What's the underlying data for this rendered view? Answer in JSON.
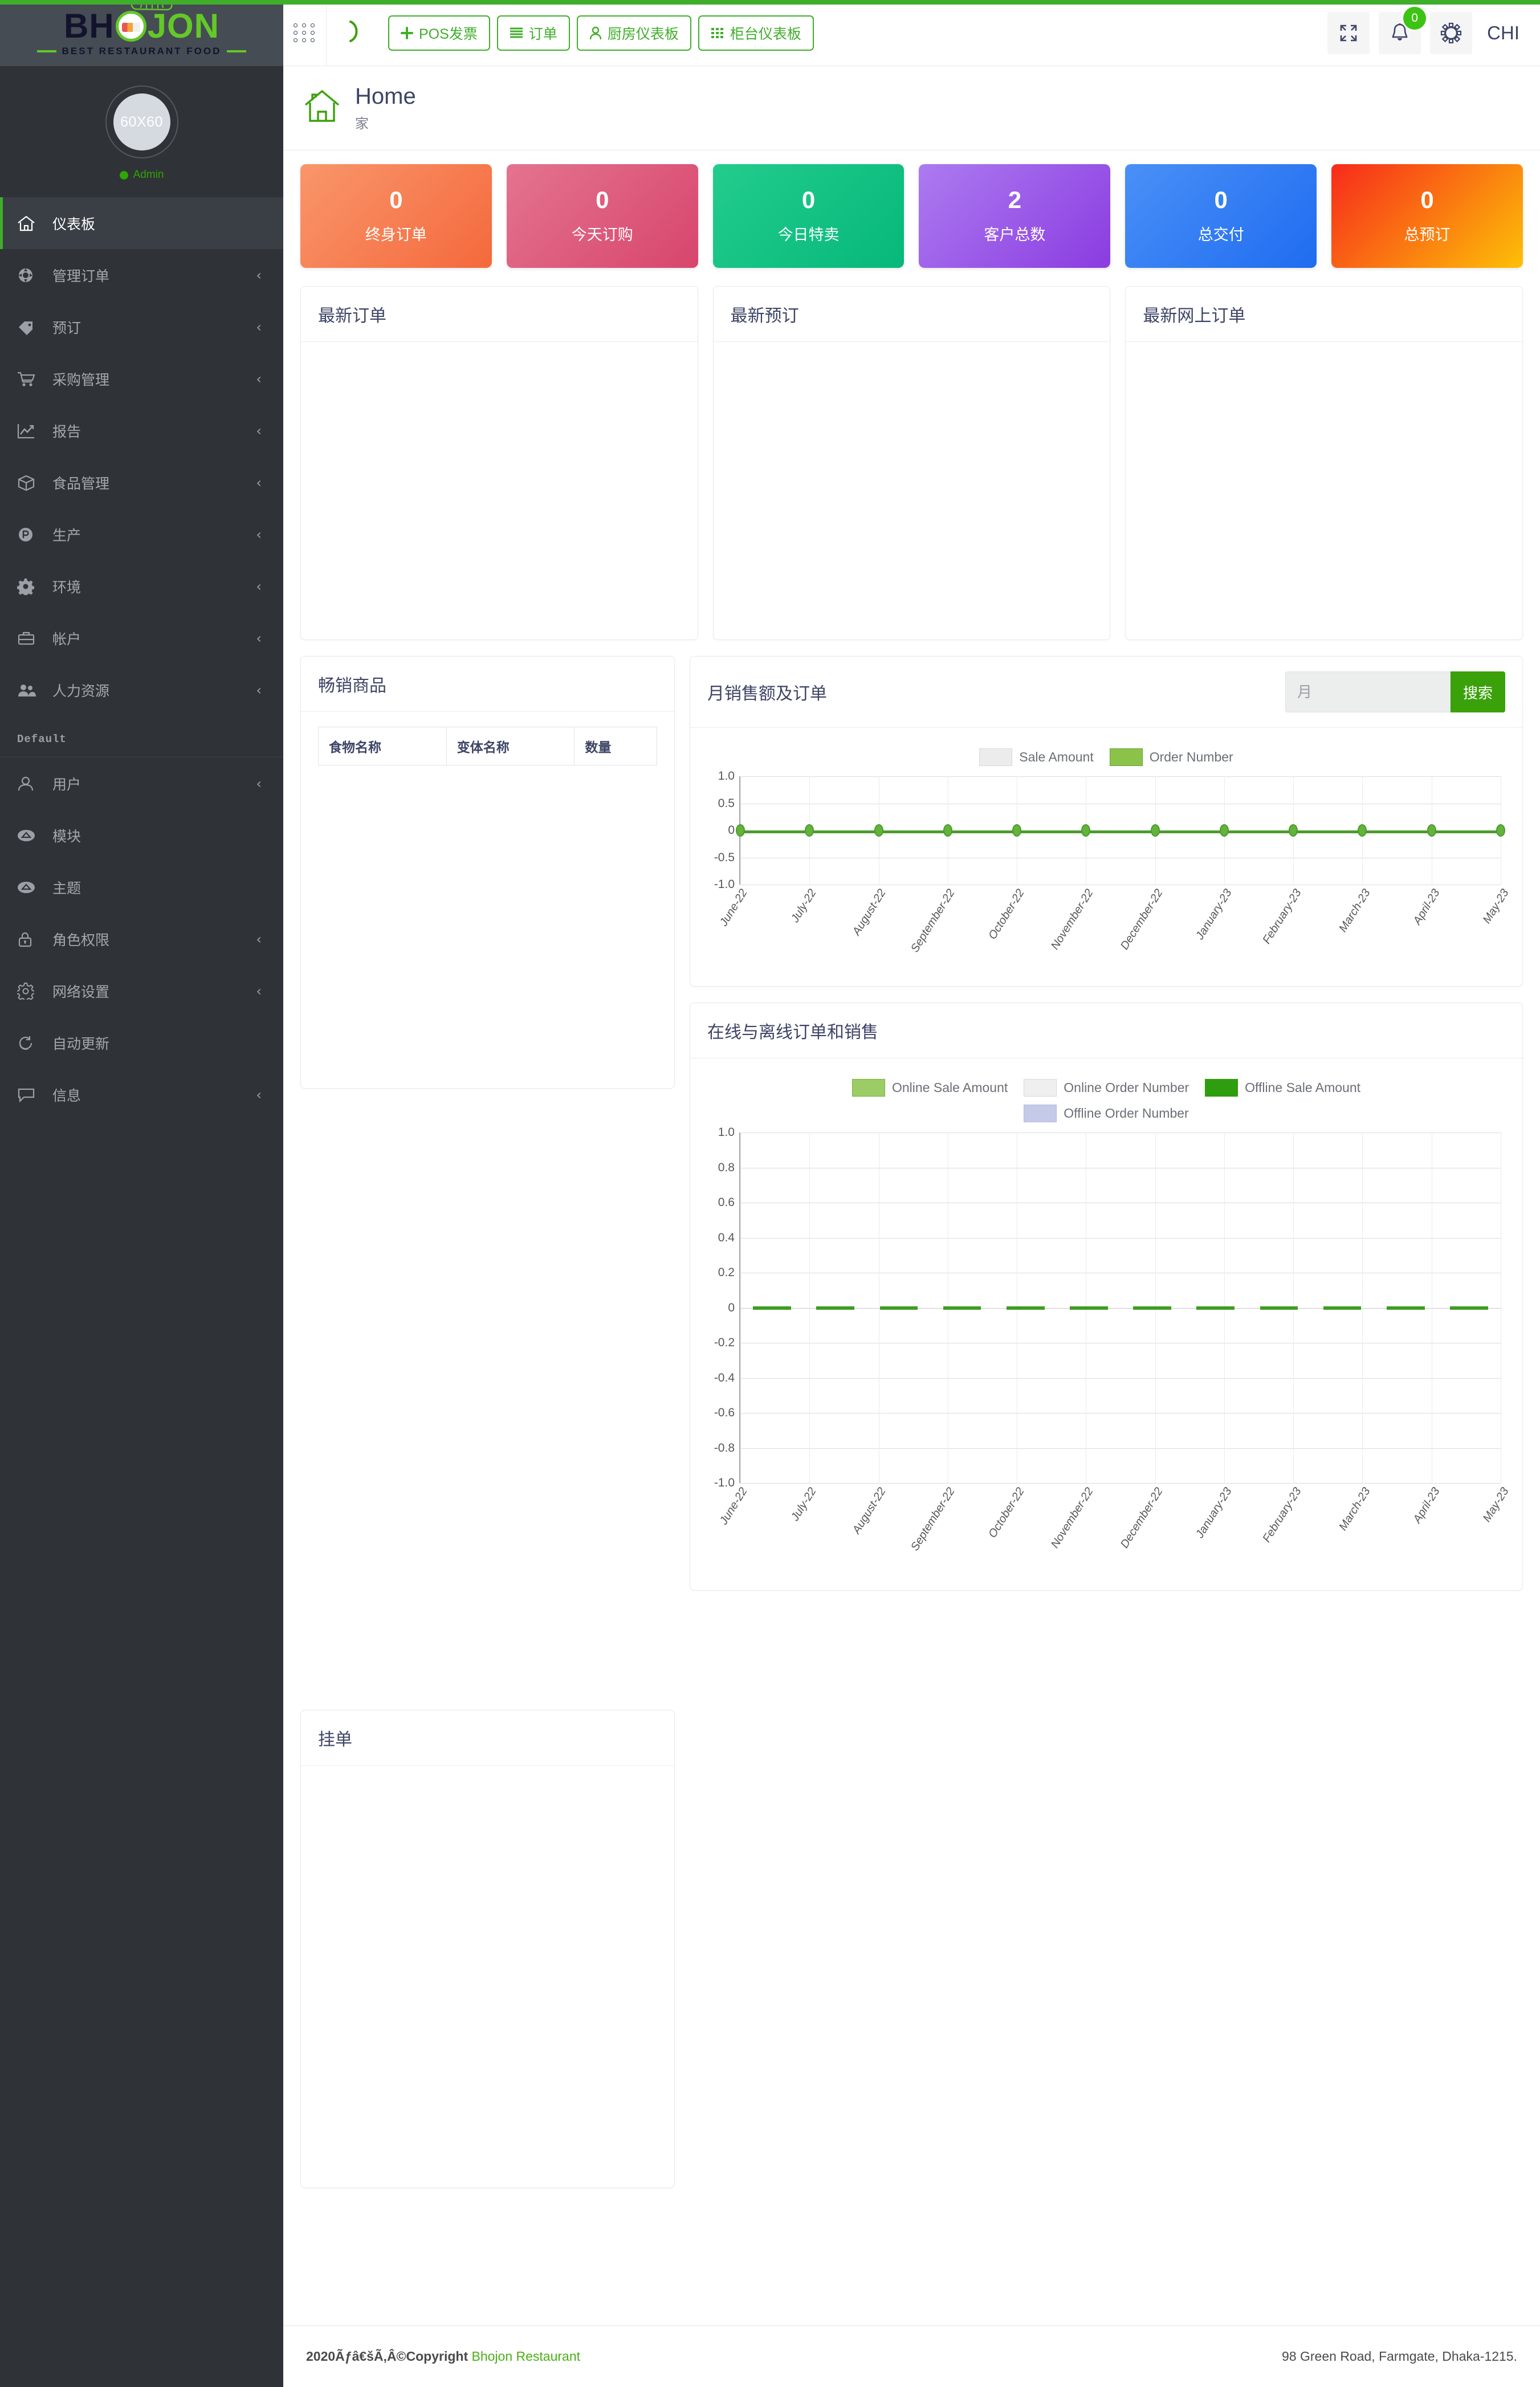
{
  "brand": {
    "logo_bh": "BH",
    "logo_jon": "JON",
    "tagline": "BEST RESTAURANT FOOD"
  },
  "sidebar": {
    "avatar_text": "60X60",
    "role": "Admin",
    "section_label": "Default",
    "items": [
      {
        "label": "仪表板",
        "icon": "home-icon",
        "caret": "",
        "active": true
      },
      {
        "label": "管理订单",
        "icon": "gear-order-icon",
        "caret": "‹",
        "active": false
      },
      {
        "label": "预订",
        "icon": "tag-icon",
        "caret": "‹",
        "active": false
      },
      {
        "label": "采购管理",
        "icon": "cart-icon",
        "caret": "‹",
        "active": false
      },
      {
        "label": "报告",
        "icon": "chart-line-icon",
        "caret": "‹",
        "active": false
      },
      {
        "label": "食品管理",
        "icon": "box-icon",
        "caret": "‹",
        "active": false
      },
      {
        "label": "生产",
        "icon": "p-circle-icon",
        "caret": "‹",
        "active": false
      },
      {
        "label": "环境",
        "icon": "cog-icon",
        "caret": "‹",
        "active": false
      },
      {
        "label": "帐户",
        "icon": "briefcase-icon",
        "caret": "‹",
        "active": false
      },
      {
        "label": "人力资源",
        "icon": "users-icon",
        "caret": "‹",
        "active": false
      }
    ],
    "items2": [
      {
        "label": "用户",
        "icon": "user-icon",
        "caret": "‹"
      },
      {
        "label": "模块",
        "icon": "module-icon",
        "caret": ""
      },
      {
        "label": "主题",
        "icon": "theme-icon",
        "caret": ""
      },
      {
        "label": "角色权限",
        "icon": "lock-icon",
        "caret": "‹"
      },
      {
        "label": "网络设置",
        "icon": "settings-gear-icon",
        "caret": "‹"
      },
      {
        "label": "自动更新",
        "icon": "refresh-icon",
        "caret": ""
      },
      {
        "label": "信息",
        "icon": "message-icon",
        "caret": "‹"
      }
    ]
  },
  "topbar": {
    "buttons": [
      {
        "label": "POS发票",
        "icon": "plus-icon"
      },
      {
        "label": "订单",
        "icon": "list-icon"
      },
      {
        "label": "厨房仪表板",
        "icon": "user-chef-icon"
      },
      {
        "label": "柜台仪表板",
        "icon": "grid-icon"
      }
    ],
    "notification_count": "0",
    "language": "CHI"
  },
  "page": {
    "title": "Home",
    "subtitle": "家"
  },
  "stats": [
    {
      "value": "0",
      "label": "终身订单",
      "c1": "#f9966b",
      "c2": "#f4693c"
    },
    {
      "value": "0",
      "label": "今天订购",
      "c1": "#e3748f",
      "c2": "#d8456c"
    },
    {
      "value": "0",
      "label": "今日特卖",
      "c1": "#22cc8d",
      "c2": "#06b87a"
    },
    {
      "value": "2",
      "label": "客户总数",
      "c1": "#ac7bf0",
      "c2": "#8b3ce0"
    },
    {
      "value": "0",
      "label": "总交付",
      "c1": "#4a90f7",
      "c2": "#1f6cf0"
    },
    {
      "value": "0",
      "label": "总预订",
      "c1": "#f72a1c",
      "c2": "#fdc007"
    }
  ],
  "cards": {
    "latest_orders": "最新订单",
    "latest_reservations": "最新预订",
    "latest_online_orders": "最新网上订单",
    "best_selling": "畅销商品",
    "held_orders": "挂单"
  },
  "best_selling_table": {
    "headers": [
      "食物名称",
      "变体名称",
      "数量"
    ],
    "rows": []
  },
  "monthly_panel": {
    "title": "月销售额及订单",
    "search_placeholder": "月",
    "search_value": "",
    "search_button": "搜索"
  },
  "onoff_panel": {
    "title": "在线与离线订单和销售"
  },
  "footer": {
    "copyright": "2020Ãƒâ€šÃ‚Â©Copyright",
    "brand_link": "Bhojon Restaurant",
    "address": "98 Green Road, Farmgate, Dhaka-1215."
  },
  "chart_data": [
    {
      "type": "line",
      "title": "月销售额及订单",
      "categories": [
        "June-22",
        "July-22",
        "August-22",
        "September-22",
        "October-22",
        "November-22",
        "December-22",
        "January-23",
        "February-23",
        "March-23",
        "April-23",
        "May-23"
      ],
      "series": [
        {
          "name": "Sale Amount",
          "color": "#ececec",
          "values": [
            0,
            0,
            0,
            0,
            0,
            0,
            0,
            0,
            0,
            0,
            0,
            0
          ]
        },
        {
          "name": "Order Number",
          "color": "#8bc34a",
          "values": [
            0,
            0,
            0,
            0,
            0,
            0,
            0,
            0,
            0,
            0,
            0,
            0
          ]
        }
      ],
      "ylim": [
        -1.0,
        1.0
      ],
      "yticks": [
        "1.0",
        "0.5",
        "0",
        "-0.5",
        "-1.0"
      ],
      "xlabel": "",
      "ylabel": "",
      "grid": true,
      "legend_position": "top"
    },
    {
      "type": "bar",
      "title": "在线与离线订单和销售",
      "categories": [
        "June-22",
        "July-22",
        "August-22",
        "September-22",
        "October-22",
        "November-22",
        "December-22",
        "January-23",
        "February-23",
        "March-23",
        "April-23",
        "May-23"
      ],
      "series": [
        {
          "name": "Online Sale Amount",
          "color": "#9ccc65",
          "values": [
            0,
            0,
            0,
            0,
            0,
            0,
            0,
            0,
            0,
            0,
            0,
            0
          ]
        },
        {
          "name": "Online Order Number",
          "color": "#efefef",
          "values": [
            0,
            0,
            0,
            0,
            0,
            0,
            0,
            0,
            0,
            0,
            0,
            0
          ]
        },
        {
          "name": "Offline Sale Amount",
          "color": "#2e9e0e",
          "values": [
            0,
            0,
            0,
            0,
            0,
            0,
            0,
            0,
            0,
            0,
            0,
            0
          ]
        },
        {
          "name": "Offline Order Number",
          "color": "#c5cae9",
          "values": [
            0,
            0,
            0,
            0,
            0,
            0,
            0,
            0,
            0,
            0,
            0,
            0
          ]
        }
      ],
      "ylim": [
        -1.0,
        1.0
      ],
      "yticks": [
        "1.0",
        "0.8",
        "0.6",
        "0.4",
        "0.2",
        "0",
        "-0.2",
        "-0.4",
        "-0.6",
        "-0.8",
        "-1.0"
      ],
      "xlabel": "",
      "ylabel": "",
      "grid": true,
      "legend_position": "top"
    }
  ]
}
